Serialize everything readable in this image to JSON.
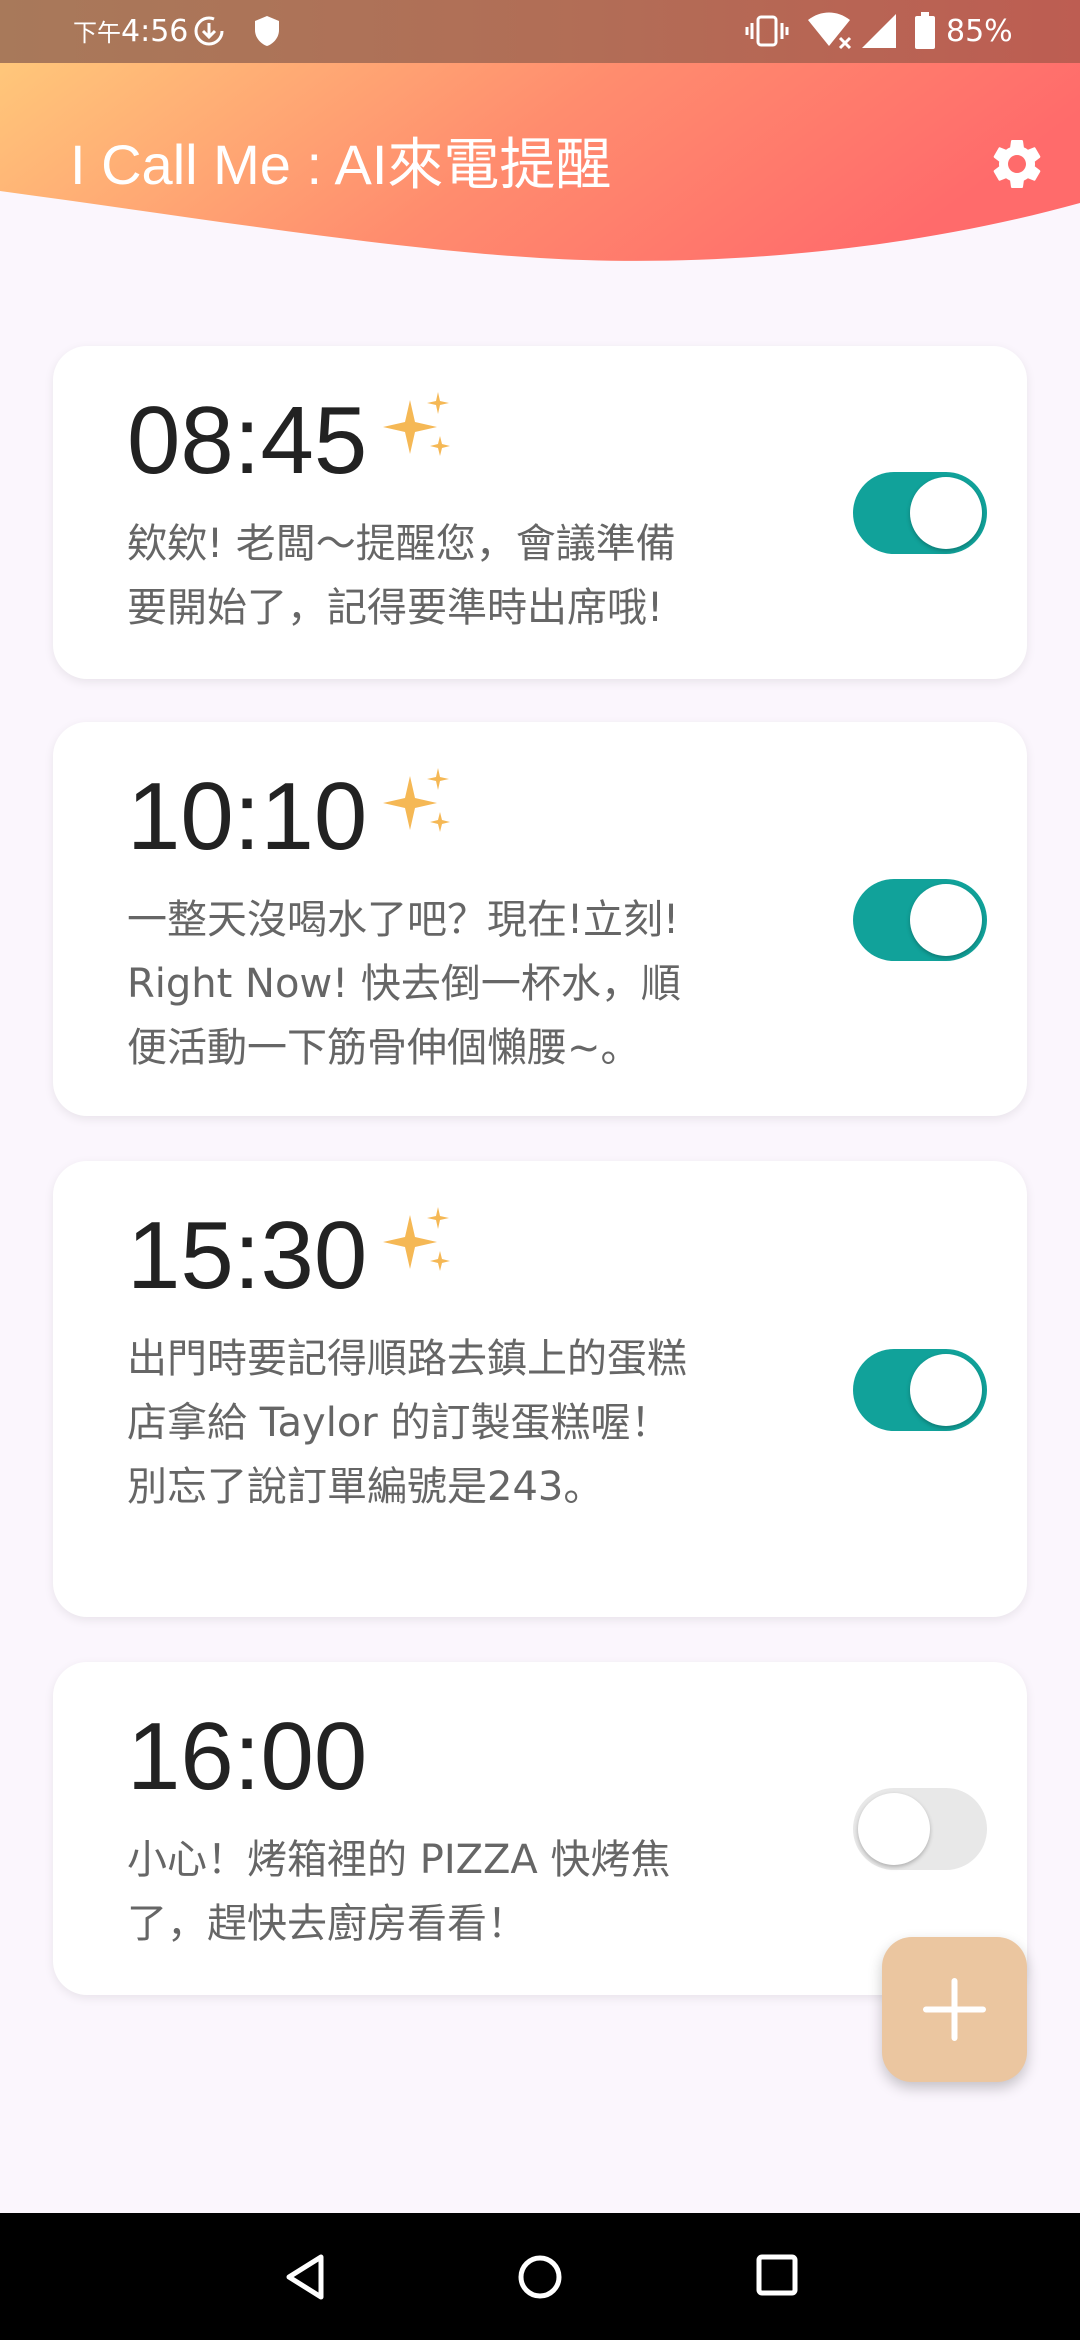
{
  "status_bar": {
    "ampm": "下午",
    "time": "4:56",
    "battery": "85%",
    "icons": [
      "download-icon",
      "shield-icon",
      "vibrate-icon",
      "wifi-icon",
      "signal-icon",
      "battery-icon"
    ]
  },
  "header": {
    "title": "I Call Me : AI來電提醒",
    "settings_icon": "gear-icon",
    "gradient": [
      "#ffc77a",
      "#ff6b6b"
    ]
  },
  "reminders": [
    {
      "time": "08:45",
      "ai_generated": true,
      "message": "欸欸! 老闆～提醒您，會議準備要開始了，記得要準時出席哦!",
      "enabled": true
    },
    {
      "time": "10:10",
      "ai_generated": true,
      "message": "一整天沒喝水了吧？現在!立刻! Right Now! 快去倒一杯水，順便活動一下筋骨伸個懶腰~。",
      "enabled": true
    },
    {
      "time": "15:30",
      "ai_generated": true,
      "message": "出門時要記得順路去鎮上的蛋糕店拿給 Taylor 的訂製蛋糕喔！別忘了說訂單編號是243。",
      "enabled": true
    },
    {
      "time": "16:00",
      "ai_generated": false,
      "message": "小心！烤箱裡的 PIZZA 快烤焦了，趕快去廚房看看！",
      "enabled": false
    }
  ],
  "fab_icon": "plus-icon",
  "colors": {
    "toggle_on": "#11a29a",
    "sparkle": "#f5b855",
    "fab": "#ebc6a0"
  },
  "nav": [
    "back-icon",
    "home-icon",
    "recent-apps-icon"
  ]
}
